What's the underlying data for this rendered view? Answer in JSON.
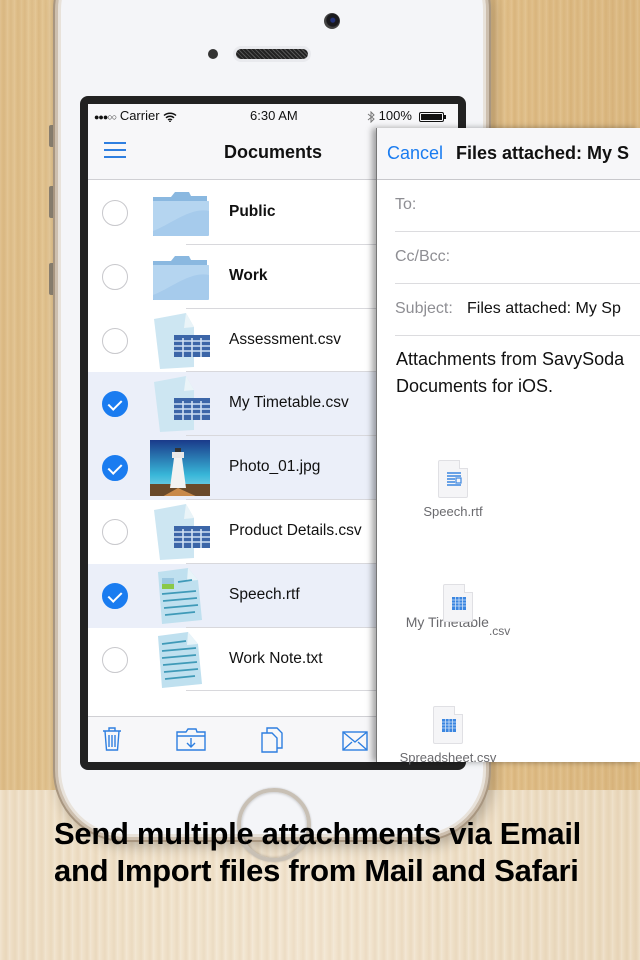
{
  "status_bar": {
    "signal": "●●●○○",
    "carrier": "Carrier",
    "wifi_icon": "wifi-icon",
    "time": "6:30 AM",
    "bluetooth_icon": "bluetooth-icon",
    "battery": "100%",
    "battery_level_percent": 100
  },
  "documents": {
    "title": "Documents",
    "menu_icon": "menu-icon",
    "files": [
      {
        "name": "Public",
        "type": "folder",
        "selected": false
      },
      {
        "name": "Work",
        "type": "folder",
        "selected": false
      },
      {
        "name": "Assessment.csv",
        "type": "csv",
        "selected": false
      },
      {
        "name": "My Timetable.csv",
        "type": "csv",
        "selected": true
      },
      {
        "name": "Photo_01.jpg",
        "type": "photo",
        "selected": true
      },
      {
        "name": "Product Details.csv",
        "type": "csv",
        "selected": false
      },
      {
        "name": "Speech.rtf",
        "type": "rtf",
        "selected": true
      },
      {
        "name": "Work Note.txt",
        "type": "txt",
        "selected": false
      }
    ],
    "toolbar": [
      "trash-icon",
      "folder-import-icon",
      "copy-icon",
      "mail-icon"
    ]
  },
  "compose": {
    "cancel_label": "Cancel",
    "title": "Files attached:  My S",
    "to_label": "To:",
    "ccbcc_label": "Cc/Bcc:",
    "subject_label": "Subject:",
    "subject_value": "Files attached:  My Sp",
    "body_line1": "Attachments from SavySoda",
    "body_line2": "Documents for iOS.",
    "attachments": [
      {
        "name": "Speech.rtf",
        "type": "rtf"
      },
      {
        "name": "My Timetable",
        "ext": ".csv",
        "type": "csv"
      },
      {
        "name": "Spreadsheet.csv",
        "type": "csv"
      }
    ]
  },
  "caption": "Send multiple attachments via Email and Import files from Mail and Safari",
  "colors": {
    "accent": "#1a7cf0",
    "selected_row": "#ebeff9"
  }
}
